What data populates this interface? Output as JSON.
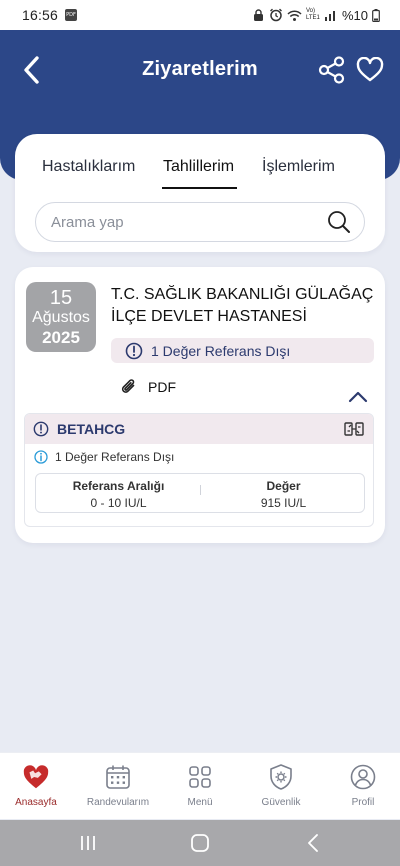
{
  "status_bar": {
    "time": "16:56",
    "net_label": "Vo) LTE1",
    "battery": "%10"
  },
  "header": {
    "title": "Ziyaretlerim",
    "color": "#2c4788"
  },
  "tabs": [
    {
      "label": "Hastalıklarım",
      "active": false
    },
    {
      "label": "Tahlillerim",
      "active": true
    },
    {
      "label": "İşlemlerim",
      "active": false
    }
  ],
  "search": {
    "placeholder": "Arama yap"
  },
  "visit": {
    "day": "15",
    "month": "Ağustos",
    "year": "2025",
    "hospital": "T.C. SAĞLIK BAKANLIĞI GÜLAĞAÇ İLÇE DEVLET HASTANESİ",
    "warning": "1 Değer Referans Dışı",
    "pdf_label": "PDF"
  },
  "test": {
    "name": "BETAHCG",
    "note": "1 Değer Referans Dışı",
    "ref_header": "Referans Aralığı",
    "value_header": "Değer",
    "ref_value": "0 - 10 IU/L",
    "value": "915 IU/L"
  },
  "bottom_nav": [
    {
      "label": "Anasayfa",
      "icon": "heart-map-icon",
      "active": true
    },
    {
      "label": "Randevularım",
      "icon": "calendar-icon",
      "active": false
    },
    {
      "label": "Menü",
      "icon": "grid-icon",
      "active": false
    },
    {
      "label": "Güvenlik",
      "icon": "shield-gear-icon",
      "active": false
    },
    {
      "label": "Profil",
      "icon": "user-icon",
      "active": false
    }
  ],
  "colors": {
    "accent": "#2c4788",
    "warning_bg": "#f1e9ee",
    "page_bg": "#e8ebf3"
  }
}
